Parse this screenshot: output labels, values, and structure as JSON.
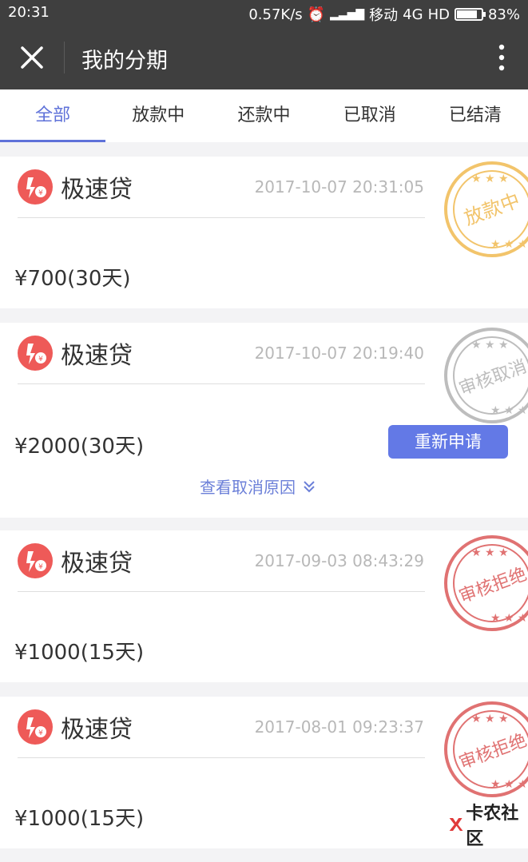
{
  "status_bar": {
    "time": "20:31",
    "speed": "0.57K/s",
    "carrier": "移动",
    "network": "4G",
    "hd": "HD",
    "battery_percent_label": "83%",
    "battery_level": 0.83
  },
  "header": {
    "title": "我的分期"
  },
  "tabs": [
    {
      "label": "全部",
      "active": true
    },
    {
      "label": "放款中",
      "active": false
    },
    {
      "label": "还款中",
      "active": false
    },
    {
      "label": "已取消",
      "active": false
    },
    {
      "label": "已结清",
      "active": false
    }
  ],
  "loans": [
    {
      "product": "极速贷",
      "time": "2017-10-07 20:31:05",
      "amount": "¥700(30天)",
      "stamp": "放款中",
      "stamp_color": "#f2c46b"
    },
    {
      "product": "极速贷",
      "time": "2017-10-07 20:19:40",
      "amount": "¥2000(30天)",
      "stamp": "审核取消",
      "stamp_color": "#bdbdbd",
      "action_label": "重新申请",
      "reason_label": "查看取消原因"
    },
    {
      "product": "极速贷",
      "time": "2017-09-03 08:43:29",
      "amount": "¥1000(15天)",
      "stamp": "审核拒绝",
      "stamp_color": "#e07272"
    },
    {
      "product": "极速贷",
      "time": "2017-08-01 09:23:37",
      "amount": "¥1000(15天)",
      "stamp": "审核拒绝",
      "stamp_color": "#e07272"
    }
  ],
  "watermark": {
    "text": "卡农社区"
  },
  "colors": {
    "accent": "#5f72d9",
    "button": "#6379e6",
    "logo": "#ee5a58",
    "header_bg": "#3f3f3f"
  }
}
